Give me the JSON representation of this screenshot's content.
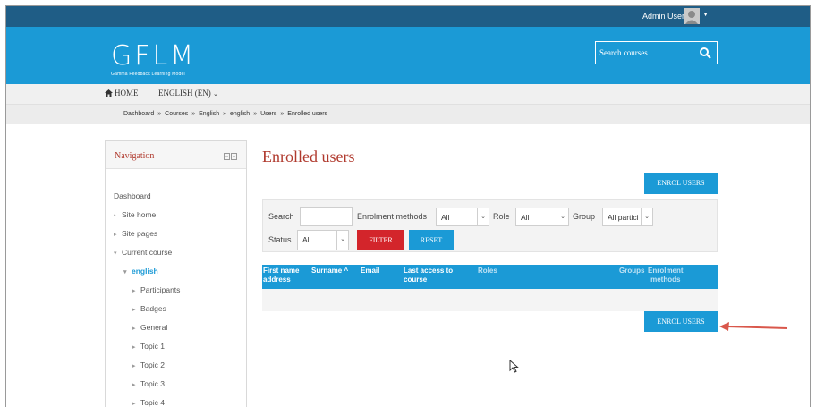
{
  "topbar": {
    "user_name": "Admin User"
  },
  "header": {
    "logo_text": "GFLM",
    "logo_subtitle": "Gamma Feedback Learning Model",
    "search_placeholder": "Search courses"
  },
  "menu": {
    "home": "HOME",
    "language": "ENGLISH (EN)"
  },
  "breadcrumb": [
    "Dashboard",
    "Courses",
    "English",
    "english",
    "Users",
    "Enrolled users"
  ],
  "navigation": {
    "title": "Navigation",
    "items": [
      {
        "label": "Dashboard",
        "marker": ""
      },
      {
        "label": "Site home",
        "marker": "•"
      },
      {
        "label": "Site pages",
        "marker": "▸"
      },
      {
        "label": "Current course",
        "marker": "▾"
      },
      {
        "label": "english",
        "marker": "▾"
      },
      {
        "label": "Participants",
        "marker": "▸"
      },
      {
        "label": "Badges",
        "marker": "▸"
      },
      {
        "label": "General",
        "marker": "▸"
      },
      {
        "label": "Topic 1",
        "marker": "▸"
      },
      {
        "label": "Topic 2",
        "marker": "▸"
      },
      {
        "label": "Topic 3",
        "marker": "▸"
      },
      {
        "label": "Topic 4",
        "marker": "▸"
      }
    ]
  },
  "main": {
    "title": "Enrolled users",
    "enrol_button": "ENROL USERS",
    "filters": {
      "search_label": "Search",
      "search_value": "",
      "enrolment_label": "Enrolment methods",
      "enrolment_value": "All",
      "role_label": "Role",
      "role_value": "All",
      "group_label": "Group",
      "group_value": "All partici",
      "status_label": "Status",
      "status_value": "All",
      "filter_button": "FILTER",
      "reset_button": "RESET"
    },
    "table": {
      "col_firstname_line1": "First name",
      "col_firstname_line2": "address",
      "col_surname": "Surname",
      "col_email": "Email",
      "col_lastaccess_line1": "Last access to",
      "col_lastaccess_line2": "course",
      "col_roles": "Roles",
      "col_groups": "Groups",
      "col_enrolment_line1": "Enrolment",
      "col_enrolment_line2": "methods"
    }
  },
  "colors": {
    "brand_blue": "#1b9ad6",
    "dark_bar": "#1f5d86",
    "filter_red": "#d3252b",
    "title_red": "#b03a2e"
  }
}
